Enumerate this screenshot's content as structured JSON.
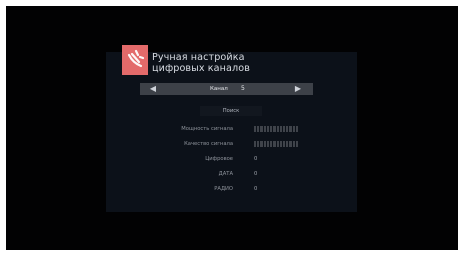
{
  "dialog": {
    "title_line1": "Ручная настройка",
    "title_line2": "цифровых каналов",
    "logo_icon": "satellite-dish-icon"
  },
  "channel_selector": {
    "label": "Канал",
    "value": "5",
    "left_arrow": "◀",
    "right_arrow": "▶"
  },
  "search_button": "Поиск",
  "signal": {
    "strength_label": "Мощность сигнала",
    "quality_label": "Качество сигнала",
    "strength_level": 0,
    "quality_level": 0
  },
  "counts": {
    "digital_label": "Цифровое",
    "digital_value": "0",
    "data_label": "ДАТА",
    "data_value": "0",
    "radio_label": "РАДИО",
    "radio_value": "0"
  },
  "colors": {
    "accent": "#e36a6a",
    "panel": "#0c1119",
    "selector": "#3d4148"
  }
}
